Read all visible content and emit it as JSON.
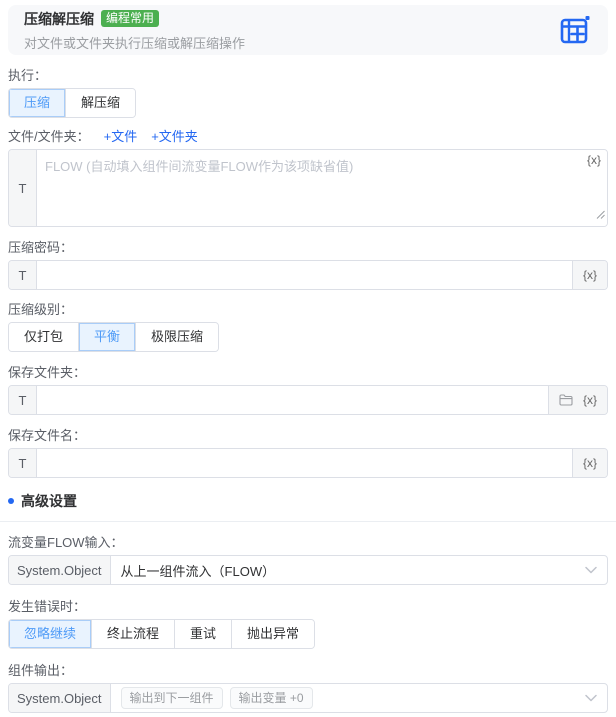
{
  "header": {
    "title": "压缩解压缩",
    "badge": "编程常用",
    "subtitle": "对文件或文件夹执行压缩或解压缩操作",
    "corner_icon": "add-component-window-icon"
  },
  "fields": {
    "action": {
      "label": "执行：",
      "options": [
        "压缩",
        "解压缩"
      ],
      "selected": "压缩"
    },
    "files": {
      "label": "文件/文件夹：",
      "links": [
        "+文件",
        "+文件夹"
      ],
      "prefix": "T",
      "placeholder": "FLOW (自动填入组件间流变量FLOW作为该项缺省值)",
      "value": "",
      "suffix": "{x}"
    },
    "password": {
      "label": "压缩密码：",
      "prefix": "T",
      "value": "",
      "suffix": "{x}"
    },
    "level": {
      "label": "压缩级别：",
      "options": [
        "仅打包",
        "平衡",
        "极限压缩"
      ],
      "selected": "平衡"
    },
    "save_folder": {
      "label": "保存文件夹：",
      "prefix": "T",
      "value": "",
      "folder_icon": "folder-icon",
      "suffix": "{x}"
    },
    "save_name": {
      "label": "保存文件名：",
      "prefix": "T",
      "value": "",
      "suffix": "{x}"
    },
    "advanced": {
      "title": "高级设置"
    },
    "flow_input": {
      "label": "流变量FLOW输入：",
      "prefix": "System.Object",
      "value": "从上一组件流入（FLOW）"
    },
    "on_error": {
      "label": "发生错误时：",
      "options": [
        "忽略继续",
        "终止流程",
        "重试",
        "抛出异常"
      ],
      "selected": "忽略继续"
    },
    "output": {
      "label": "组件输出：",
      "prefix": "System.Object",
      "tags": [
        "输出到下一组件",
        "输出变量 +0"
      ]
    }
  },
  "colors": {
    "accent_blue": "#2468f2",
    "badge_green": "#4caf50",
    "selected_bg": "#e9f3fe",
    "selected_text": "#4f9bf7",
    "border": "#dcdfe6",
    "label_text": "#5a5e66",
    "placeholder": "#c0c4cc",
    "header_bg": "#f7f8fa"
  }
}
